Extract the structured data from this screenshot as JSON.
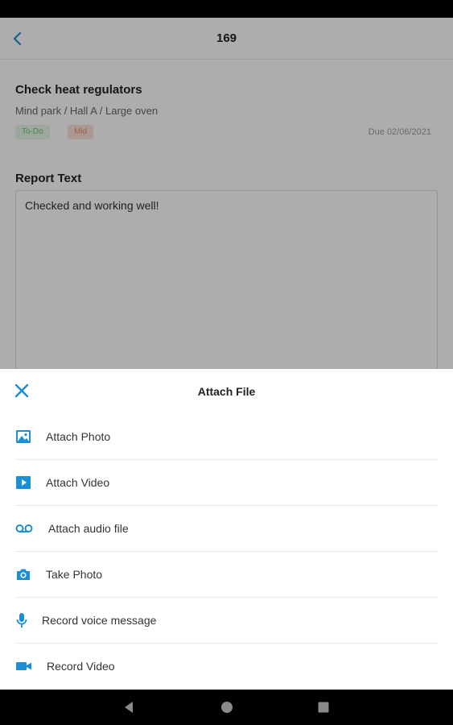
{
  "header": {
    "title": "169"
  },
  "task": {
    "title": "Check heat regulators",
    "path": "Mind park / Hall A / Large oven",
    "status": "To-Do",
    "priority": "Mid",
    "due": "Due 02/06/2021"
  },
  "report": {
    "label": "Report Text",
    "value": "Checked and working well!"
  },
  "sheet": {
    "title": "Attach File",
    "items": [
      {
        "label": "Attach Photo",
        "icon": "image-icon"
      },
      {
        "label": "Attach Video",
        "icon": "video-file-icon"
      },
      {
        "label": "Attach audio file",
        "icon": "voicemail-icon"
      },
      {
        "label": "Take Photo",
        "icon": "camera-icon"
      },
      {
        "label": "Record voice message",
        "icon": "microphone-icon"
      },
      {
        "label": "Record Video",
        "icon": "videocam-icon"
      }
    ]
  },
  "colors": {
    "accent": "#1a8fd6",
    "status_badge_bg": "#e7f6e7",
    "status_badge_text": "#6cc46c",
    "priority_badge_bg": "#fde4d9",
    "priority_badge_text": "#ee8a63"
  }
}
